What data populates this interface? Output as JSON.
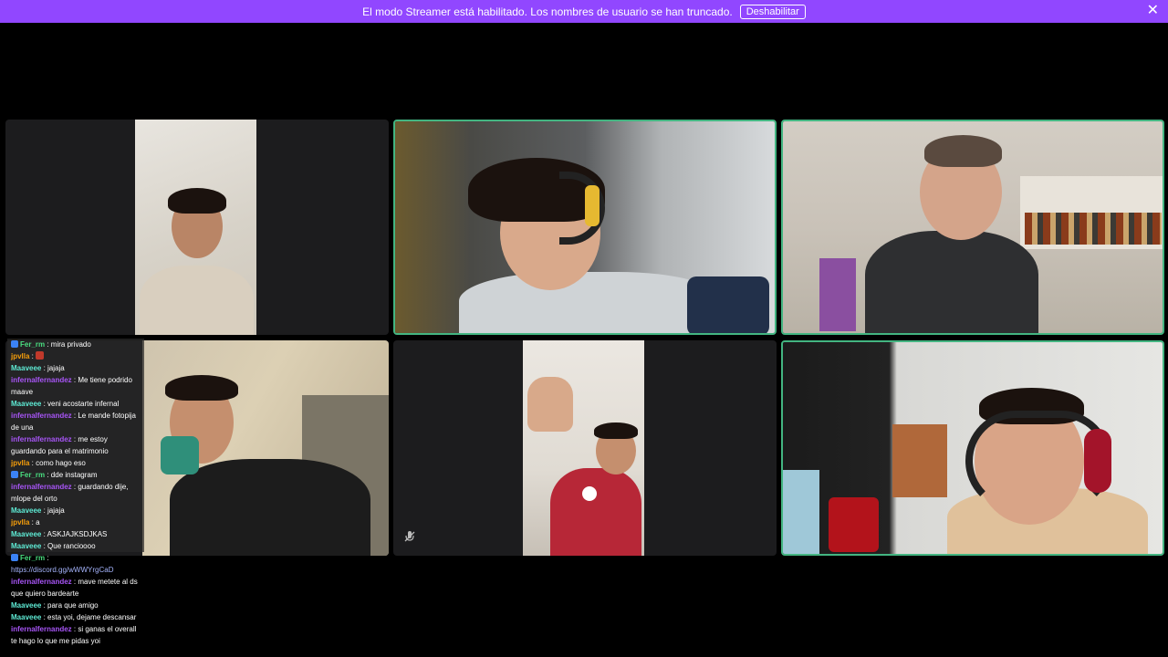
{
  "banner": {
    "message": "El modo Streamer está habilitado. Los nombres de usuario se han truncado.",
    "button_label": "Deshabilitar",
    "close_glyph": "✕"
  },
  "tiles": [
    {
      "name": "participant-1",
      "speaking": false
    },
    {
      "name": "participant-2",
      "speaking": true
    },
    {
      "name": "participant-3",
      "speaking": true
    },
    {
      "name": "participant-4",
      "speaking": false
    },
    {
      "name": "participant-5",
      "speaking": false,
      "muted_icon": "mic-off-icon"
    },
    {
      "name": "participant-6",
      "speaking": true
    }
  ],
  "chat": [
    {
      "user": "Fer_rm",
      "color": "#4ade80",
      "text": "mira privado",
      "badge": true,
      "bg": true
    },
    {
      "user": "jpvlla",
      "color": "#f59e0b",
      "text": "",
      "emote": true,
      "bg": true
    },
    {
      "user": "Maaveee",
      "color": "#5eead4",
      "text": "jajaja",
      "bg": true
    },
    {
      "user": "infernalfernandez",
      "color": "#a855f7",
      "text": "Me tiene podrido maave",
      "bg": true
    },
    {
      "user": "Maaveee",
      "color": "#5eead4",
      "text": "veni acostarte infernal",
      "bg": true
    },
    {
      "user": "infernalfernandez",
      "color": "#a855f7",
      "text": "Le mande fotopija de una",
      "bg": true
    },
    {
      "user": "infernalfernandez",
      "color": "#a855f7",
      "text": "me estoy guardando para el matrimonio",
      "bg": true
    },
    {
      "user": "jpvlla",
      "color": "#f59e0b",
      "text": "como hago eso",
      "bg": true
    },
    {
      "user": "Fer_rm",
      "color": "#4ade80",
      "text": "dde instagram",
      "badge": true,
      "bg": true
    },
    {
      "user": "infernalfernandez",
      "color": "#a855f7",
      "text": "guardando dije, mlope del orto",
      "bg": true
    },
    {
      "user": "Maaveee",
      "color": "#5eead4",
      "text": "jajaja",
      "bg": true
    },
    {
      "user": "jpvlla",
      "color": "#f59e0b",
      "text": "a",
      "bg": true
    },
    {
      "user": "Maaveee",
      "color": "#5eead4",
      "text": "ASKJAJKSDJKAS",
      "bg": true
    },
    {
      "user": "Maaveee",
      "color": "#5eead4",
      "text": "Que rancioooo",
      "bg": true
    },
    {
      "user": "Fer_rm",
      "color": "#4ade80",
      "text": "https://discord.gg/wWWYrgCaD",
      "badge": true,
      "bg": false,
      "link": true
    },
    {
      "user": "infernalfernandez",
      "color": "#a855f7",
      "text": "mave metete al ds que quiero bardearte",
      "bg": false
    },
    {
      "user": "Maaveee",
      "color": "#5eead4",
      "text": "para que amigo",
      "bg": false
    },
    {
      "user": "Maaveee",
      "color": "#5eead4",
      "text": "esta yoi, dejame descansar",
      "bg": false
    },
    {
      "user": "infernalfernandez",
      "color": "#a855f7",
      "text": "si ganas el overall te hago lo que me pidas yoi",
      "bg": false
    }
  ],
  "colors": {
    "accent": "#9147ff",
    "speaking": "#43b581"
  }
}
